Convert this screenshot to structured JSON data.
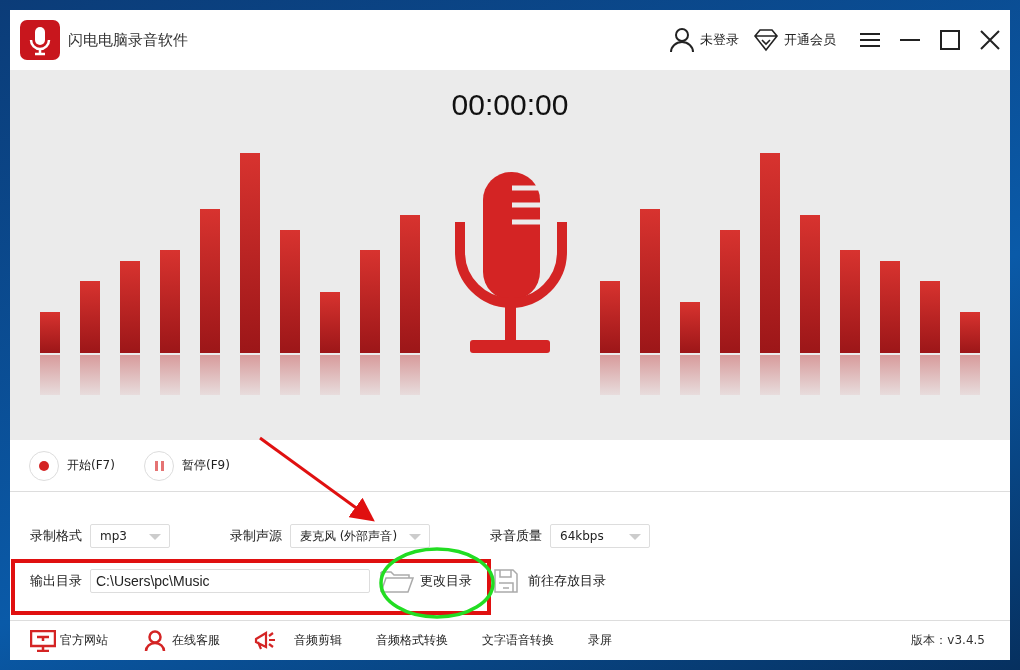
{
  "window": {
    "title": "闪电电脑录音软件"
  },
  "header_actions": [
    {
      "kind": "user",
      "label": "未登录"
    },
    {
      "kind": "vip",
      "label": "开通会员"
    }
  ],
  "timer": "00:00:00",
  "record_controls": [
    {
      "kind": "start",
      "label": "开始(F7)"
    },
    {
      "kind": "pause",
      "label": "暂停(F9)"
    }
  ],
  "settings": [
    {
      "label": "录制格式",
      "value": "mp3"
    },
    {
      "label": "录制声源",
      "value": "麦克风 (外部声音)"
    },
    {
      "label": "录音质量",
      "value": "64kbps"
    }
  ],
  "output": {
    "label": "输出目录",
    "value": "C:\\Users\\pc\\Music",
    "change_button": "更改目录",
    "open_button": "前往存放目录"
  },
  "footer_links": [
    {
      "kind": "website",
      "label": "官方网站"
    },
    {
      "kind": "service",
      "label": "在线客服"
    },
    {
      "kind": "edit",
      "label": "音频剪辑"
    },
    {
      "kind": "plain",
      "label": "音频格式转换"
    },
    {
      "kind": "plain",
      "label": "文字语音转换"
    },
    {
      "kind": "plain",
      "label": "录屏"
    }
  ],
  "version": "版本：v3.4.5"
}
